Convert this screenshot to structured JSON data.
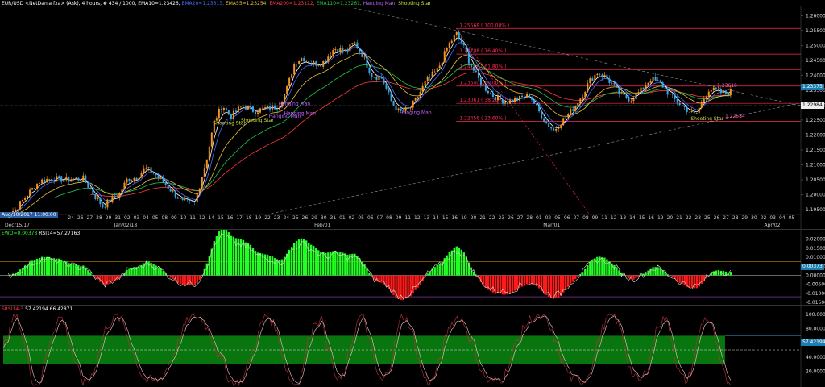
{
  "main": {
    "title_parts": [
      {
        "text": "EUR/USD <NetDania fxa> (Ask), 4 hours, # 434 / 1000, EMA10=1.23426",
        "color": "#ffffff"
      },
      {
        "text": "EMA20=1.23313",
        "color": "#4a6dff"
      },
      {
        "text": "EMA55=1.23254",
        "color": "#e8c040"
      },
      {
        "text": "EMA200=1.23122",
        "color": "#ff3a3a"
      },
      {
        "text": "EMA110=1.23261",
        "color": "#22c84a"
      },
      {
        "text": "Hanging Man",
        "color": "#c060ff"
      },
      {
        "text": "Shooting Star",
        "color": "#c8e040"
      }
    ],
    "price_ticks": [
      "1.26000",
      "1.25500",
      "1.25000",
      "1.24500",
      "1.24000",
      "1.23500",
      "1.23000",
      "1.22500",
      "1.22000",
      "1.21500",
      "1.21000",
      "1.20500",
      "1.20000",
      "1.19500"
    ],
    "last_price_tag": "1.23375",
    "cursor_price_tag": "1.22984",
    "cursor_date_tag": "Aug/10/2017 11:00:00",
    "day_ticks": [
      "24",
      "26",
      "27",
      "28",
      "29",
      "31",
      "02",
      "03",
      "04",
      "05",
      "08",
      "09",
      "10",
      "11",
      "12",
      "14",
      "15",
      "16",
      "17",
      "18",
      "19",
      "22",
      "23",
      "24",
      "25",
      "26",
      "29",
      "30",
      "31",
      "01",
      "02",
      "05",
      "06",
      "07",
      "08",
      "09",
      "11",
      "12",
      "13",
      "14",
      "15",
      "16",
      "19",
      "20",
      "21",
      "22",
      "23",
      "26",
      "27",
      "28",
      "01",
      "02",
      "05",
      "06",
      "07",
      "08",
      "09",
      "11",
      "12",
      "13",
      "14",
      "15",
      "16",
      "19",
      "20",
      "21",
      "22",
      "23",
      "25",
      "26",
      "27",
      "28",
      "29",
      "30",
      "02",
      "03",
      "04",
      "05"
    ],
    "month_labels": [
      {
        "text": "Dec/15/17",
        "pos": 0.0
      },
      {
        "text": "Jan/02/18",
        "pos": 0.137
      },
      {
        "text": "Feb/01",
        "pos": 0.388
      },
      {
        "text": "Mar/01",
        "pos": 0.675
      },
      {
        "text": "Apr/02",
        "pos": 0.952
      }
    ],
    "fib_levels": [
      {
        "label": "1.25568 ( 100.00% )",
        "price": 1.25568
      },
      {
        "label": "1.24708 ( 76.40% )",
        "price": 1.24708
      },
      {
        "label": "1.24188 ( 61.80% )",
        "price": 1.24188
      },
      {
        "label": "1.23640 ( 50.00% )",
        "price": 1.2364
      },
      {
        "label": "1.23061 ( 38.20% )",
        "price": 1.23061
      },
      {
        "label": "1.22456 ( 23.60% )",
        "price": 1.22456
      }
    ],
    "annotations": [
      {
        "text": "1.23610",
        "price": 1.2361,
        "pos": 0.895,
        "color": "#ff6ab0"
      },
      {
        "text": "1.22584",
        "price": 1.2258,
        "pos": 0.905,
        "color": "#ff6ab0"
      }
    ],
    "patterns": [
      {
        "text": "Hanging Man",
        "price": 1.23,
        "pos": 0.345,
        "color": "#c060ff"
      },
      {
        "text": "Hanging Man",
        "price": 1.2268,
        "pos": 0.352,
        "color": "#c060ff"
      },
      {
        "text": "Hanging Man",
        "price": 1.2258,
        "pos": 0.333,
        "color": "#c060ff"
      },
      {
        "text": "Shooting Star",
        "price": 1.2245,
        "pos": 0.298,
        "color": "#c8e040"
      },
      {
        "text": "Shooting Star",
        "price": 1.2235,
        "pos": 0.263,
        "color": "#c8e040"
      },
      {
        "text": "Hanging Man",
        "price": 1.227,
        "pos": 0.497,
        "color": "#c060ff"
      },
      {
        "text": "Shooting Star",
        "price": 1.225,
        "pos": 0.862,
        "color": "#c8e040"
      }
    ]
  },
  "ewo": {
    "title_a": "EWO=0.00373",
    "title_b": "RSI14=57.27163",
    "ticks": [
      "0.02000",
      "0.01500",
      "0.01000",
      "0.00500",
      "0.00000",
      "-0.00500",
      "-0.01000",
      "-0.01500"
    ],
    "value_tag": "0.00373"
  },
  "srsi": {
    "title_a": "SRSI14-3",
    "title_b": "57.42194",
    "title_c": "66.42871",
    "ticks": [
      "100.00000",
      "80.00000",
      "60.00000",
      "40.00000",
      "20.00000"
    ],
    "value_tag": "57.42194"
  },
  "colors": {
    "bull": "#f7941d",
    "bear": "#38a8e0",
    "ema10": "#ffffff",
    "ema20": "#4a6dff",
    "ema55": "#e8c040",
    "ema110": "#22c84a",
    "ema200": "#ff3a3a",
    "fib": "#ff2a55",
    "hist_pos": "#22ff22",
    "hist_neg": "#ff1a1a",
    "band": "#0a8a12"
  },
  "chart_data": {
    "type": "candlestick",
    "instrument": "EUR/USD",
    "timeframe": "4 hours",
    "ylim": [
      1.1945,
      1.2625
    ],
    "anchors": [
      [
        0.0,
        1.193
      ],
      [
        0.015,
        1.195
      ],
      [
        0.03,
        1.2
      ],
      [
        0.045,
        1.2045
      ],
      [
        0.06,
        1.2055
      ],
      [
        0.08,
        1.205
      ],
      [
        0.1,
        1.2055
      ],
      [
        0.115,
        1.1995
      ],
      [
        0.125,
        1.196
      ],
      [
        0.135,
        1.1985
      ],
      [
        0.145,
        1.2
      ],
      [
        0.155,
        1.205
      ],
      [
        0.168,
        1.206
      ],
      [
        0.178,
        1.209
      ],
      [
        0.19,
        1.207
      ],
      [
        0.205,
        1.203
      ],
      [
        0.225,
        1.1975
      ],
      [
        0.24,
        1.197
      ],
      [
        0.255,
        1.212
      ],
      [
        0.265,
        1.225
      ],
      [
        0.275,
        1.23
      ],
      [
        0.285,
        1.226
      ],
      [
        0.3,
        1.23
      ],
      [
        0.315,
        1.228
      ],
      [
        0.33,
        1.229
      ],
      [
        0.345,
        1.2295
      ],
      [
        0.355,
        1.235
      ],
      [
        0.365,
        1.244
      ],
      [
        0.375,
        1.246
      ],
      [
        0.385,
        1.244
      ],
      [
        0.4,
        1.244
      ],
      [
        0.415,
        1.249
      ],
      [
        0.43,
        1.248
      ],
      [
        0.44,
        1.251
      ],
      [
        0.45,
        1.247
      ],
      [
        0.462,
        1.24
      ],
      [
        0.475,
        1.239
      ],
      [
        0.487,
        1.231
      ],
      [
        0.497,
        1.2275
      ],
      [
        0.51,
        1.229
      ],
      [
        0.52,
        1.233
      ],
      [
        0.53,
        1.238
      ],
      [
        0.545,
        1.242
      ],
      [
        0.558,
        1.25
      ],
      [
        0.568,
        1.254
      ],
      [
        0.575,
        1.251
      ],
      [
        0.585,
        1.244
      ],
      [
        0.595,
        1.239
      ],
      [
        0.605,
        1.2355
      ],
      [
        0.615,
        1.233
      ],
      [
        0.63,
        1.231
      ],
      [
        0.645,
        1.232
      ],
      [
        0.66,
        1.2335
      ],
      [
        0.67,
        1.2285
      ],
      [
        0.68,
        1.2245
      ],
      [
        0.69,
        1.2215
      ],
      [
        0.7,
        1.2245
      ],
      [
        0.712,
        1.228
      ],
      [
        0.725,
        1.233
      ],
      [
        0.735,
        1.238
      ],
      [
        0.745,
        1.241
      ],
      [
        0.755,
        1.2395
      ],
      [
        0.765,
        1.2365
      ],
      [
        0.775,
        1.233
      ],
      [
        0.787,
        1.232
      ],
      [
        0.8,
        1.235
      ],
      [
        0.812,
        1.239
      ],
      [
        0.825,
        1.237
      ],
      [
        0.837,
        1.233
      ],
      [
        0.85,
        1.23
      ],
      [
        0.86,
        1.228
      ],
      [
        0.868,
        1.2265
      ],
      [
        0.876,
        1.231
      ],
      [
        0.885,
        1.2355
      ],
      [
        0.895,
        1.2345
      ],
      [
        0.905,
        1.234
      ],
      [
        0.912,
        1.2345
      ]
    ],
    "fib_retracements": [
      1.25568,
      1.24708,
      1.24188,
      1.2364,
      1.23061,
      1.22456
    ],
    "indicators": {
      "EMA10": 1.23426,
      "EMA20": 1.23313,
      "EMA55": 1.23254,
      "EMA110": 1.23261,
      "EMA200": 1.23122,
      "EWO": 0.00373,
      "RSI14": 57.27163,
      "SRSI14-3": 57.42194,
      "SRSI_signal": 66.42871
    },
    "ewo_range": [
      -0.0158,
      0.0225
    ],
    "srsi_range": [
      0,
      108
    ]
  }
}
